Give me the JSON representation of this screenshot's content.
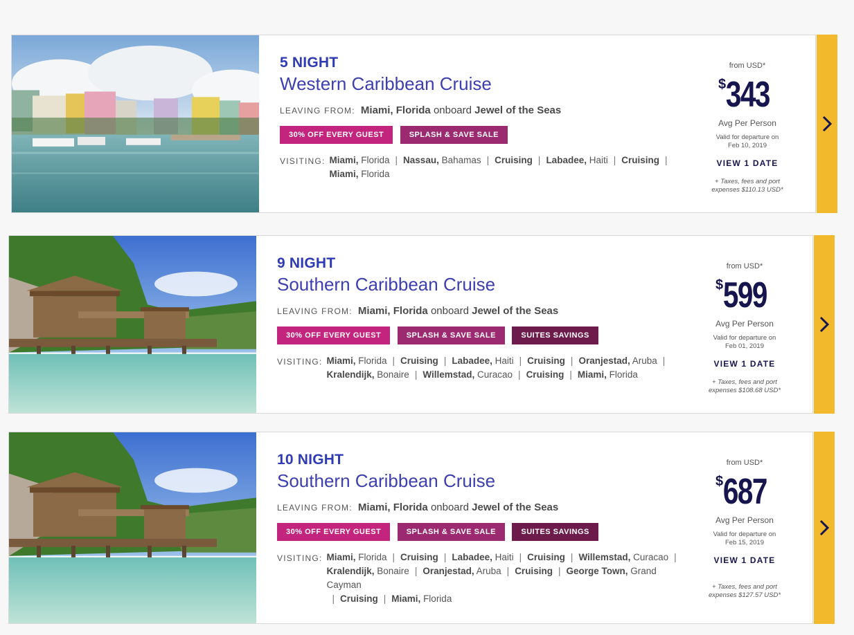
{
  "cards": [
    {
      "nights": "5 NIGHT",
      "title": "Western Caribbean Cruise",
      "leaving_label": "LEAVING FROM:",
      "leaving_port": "Miami, Florida",
      "onboard_word": "onboard",
      "ship": "Jewel of the Seas",
      "badges": [
        "30% OFF EVERY GUEST",
        "SPLASH & SAVE SALE"
      ],
      "visiting_label": "VISITING:",
      "ports": [
        {
          "name": "Miami,",
          "region": "Florida"
        },
        {
          "name": "Nassau,",
          "region": "Bahamas"
        },
        {
          "name": "Cruising",
          "region": ""
        },
        {
          "name": "Labadee,",
          "region": "Haiti"
        },
        {
          "name": "Cruising",
          "region": ""
        },
        {
          "name": "Miami,",
          "region": "Florida"
        }
      ],
      "from_label": "from USD*",
      "currency": "$",
      "price": "343",
      "avg_label": "Avg Per Person",
      "valid_line1": "Valid for departure on",
      "valid_date": "Feb 10, 2019",
      "view_label": "VIEW 1 DATE",
      "taxes_line1": "+ Taxes, fees and port",
      "taxes_line2": "expenses $110.13 USD*",
      "image": "marina"
    },
    {
      "nights": "9 NIGHT",
      "title": "Southern Caribbean Cruise",
      "leaving_label": "LEAVING FROM:",
      "leaving_port": "Miami, Florida",
      "onboard_word": "onboard",
      "ship": "Jewel of the Seas",
      "badges": [
        "30% OFF EVERY GUEST",
        "SPLASH & SAVE SALE",
        "SUITES SAVINGS"
      ],
      "visiting_label": "VISITING:",
      "ports": [
        {
          "name": "Miami,",
          "region": "Florida"
        },
        {
          "name": "Cruising",
          "region": ""
        },
        {
          "name": "Labadee,",
          "region": "Haiti"
        },
        {
          "name": "Cruising",
          "region": ""
        },
        {
          "name": "Oranjestad,",
          "region": "Aruba"
        },
        {
          "name": "Kralendijk,",
          "region": "Bonaire"
        },
        {
          "name": "Willemstad,",
          "region": "Curacao"
        },
        {
          "name": "Cruising",
          "region": ""
        },
        {
          "name": "Miami,",
          "region": "Florida"
        }
      ],
      "from_label": "from USD*",
      "currency": "$",
      "price": "599",
      "avg_label": "Avg Per Person",
      "valid_line1": "Valid for departure on",
      "valid_date": "Feb 01, 2019",
      "view_label": "VIEW 1 DATE",
      "taxes_line1": "+ Taxes, fees and port",
      "taxes_line2": "expenses $108.68 USD*",
      "image": "huts"
    },
    {
      "nights": "10 NIGHT",
      "title": "Southern Caribbean Cruise",
      "leaving_label": "LEAVING FROM:",
      "leaving_port": "Miami, Florida",
      "onboard_word": "onboard",
      "ship": "Jewel of the Seas",
      "badges": [
        "30% OFF EVERY GUEST",
        "SPLASH & SAVE SALE",
        "SUITES SAVINGS"
      ],
      "visiting_label": "VISITING:",
      "ports": [
        {
          "name": "Miami,",
          "region": "Florida"
        },
        {
          "name": "Cruising",
          "region": ""
        },
        {
          "name": "Labadee,",
          "region": "Haiti"
        },
        {
          "name": "Cruising",
          "region": ""
        },
        {
          "name": "Willemstad,",
          "region": "Curacao"
        },
        {
          "name": "Kralendijk,",
          "region": "Bonaire"
        },
        {
          "name": "Oranjestad,",
          "region": "Aruba"
        },
        {
          "name": "Cruising",
          "region": ""
        },
        {
          "name": "George Town,",
          "region": "Grand Cayman"
        },
        {
          "name": "Cruising",
          "region": ""
        },
        {
          "name": "Miami,",
          "region": "Florida"
        }
      ],
      "from_label": "from USD*",
      "currency": "$",
      "price": "687",
      "avg_label": "Avg Per Person",
      "valid_line1": "Valid for departure on",
      "valid_date": "Feb 15, 2019",
      "view_label": "VIEW 1 DATE",
      "taxes_line1": "+ Taxes, fees and port",
      "taxes_line2": "expenses $127.57 USD*",
      "image": "huts"
    }
  ],
  "colors": {
    "nights": "#2f3bb3",
    "title": "#3d3fb0",
    "price": "#16154e",
    "arrow_tab": "#f2b92c",
    "badge_off": "#c2247e",
    "badge_splash": "#9b2a71",
    "badge_suites": "#6d1b4b"
  }
}
